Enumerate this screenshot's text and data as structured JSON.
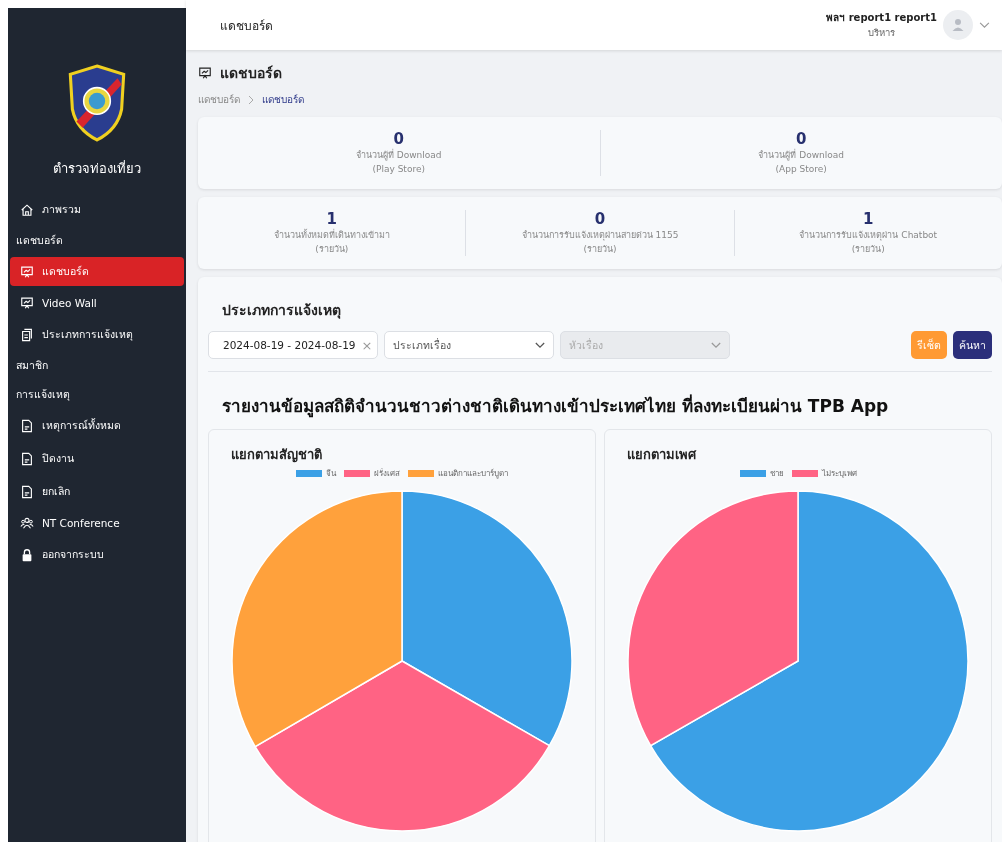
{
  "sidebar": {
    "brand": "ตำรวจท่องเที่ยว",
    "items": [
      {
        "kind": "link",
        "label": "ภาพรวม",
        "selected": false
      },
      {
        "kind": "section",
        "label": "แดชบอร์ด"
      },
      {
        "kind": "link",
        "label": "แดชบอร์ด",
        "selected": true
      },
      {
        "kind": "link",
        "label": "Video Wall",
        "selected": false
      },
      {
        "kind": "link",
        "label": "ประเภทการแจ้งเหตุ",
        "selected": false
      },
      {
        "kind": "section",
        "label": "สมาชิก"
      },
      {
        "kind": "section",
        "label": "การแจ้งเหตุ"
      },
      {
        "kind": "link",
        "label": "เหตุการณ์ทั้งหมด",
        "selected": false
      },
      {
        "kind": "link",
        "label": "ปิดงาน",
        "selected": false
      },
      {
        "kind": "link",
        "label": "ยกเลิก",
        "selected": false
      },
      {
        "kind": "link",
        "label": "NT Conference",
        "selected": false
      },
      {
        "kind": "link",
        "label": "ออกจากระบบ",
        "selected": false
      }
    ]
  },
  "header": {
    "title": "แดชบอร์ด",
    "user_name": "พลฯ report1 report1",
    "user_role": "บริหาร"
  },
  "page": {
    "title": "แดชบอร์ด",
    "breadcrumb": [
      "แดชบอร์ด",
      "แดชบอร์ด"
    ]
  },
  "stat_rows": [
    [
      {
        "value": "0",
        "label": "จำนวนผู้ที่ Download",
        "sub": "(Play Store)"
      },
      {
        "value": "0",
        "label": "จำนวนผู้ที่ Download",
        "sub": "(App Store)"
      }
    ],
    [
      {
        "value": "1",
        "label": "จำนวนทั้งหมดที่เดินทางเข้ามา",
        "sub": "(รายวัน)"
      },
      {
        "value": "0",
        "label": "จำนวนการรับแจ้งเหตุผ่านสายด่วน 1155",
        "sub": "(รายวัน)"
      },
      {
        "value": "1",
        "label": "จำนวนการรับแจ้งเหตุผ่าน Chatbot",
        "sub": "(รายวัน)"
      }
    ]
  ],
  "report": {
    "title": "ประเภทการแจ้งเหตุ",
    "filters": {
      "date_range": "2024-08-19 - 2024-08-19",
      "clear": "×",
      "type": {
        "placeholder": "ประเภทเรื่อง",
        "disabled": false
      },
      "topic": {
        "placeholder": "หัวเรื่อง",
        "disabled": true
      }
    },
    "buttons": {
      "reset": "รีเซ็ต",
      "search": "ค้นหา"
    },
    "heading": "รายงานข้อมูลสถิติจำนวนชาวต่างชาติเดินทางเข้าประเทศไทย ที่ลงทะเบียนผ่าน TPB App",
    "charts": [
      {
        "title": "แยกตามสัญชาติ",
        "chart_data": {
          "type": "pie",
          "categories": [
            "จีน",
            "ฝรั่งเศส",
            "แอนติกาและบาร์บูดา"
          ],
          "values": [
            33.3,
            33.3,
            33.4
          ],
          "colors": [
            "#3ba0e6",
            "#ff6384",
            "#ffa13c"
          ]
        }
      },
      {
        "title": "แยกตามเพศ",
        "chart_data": {
          "type": "pie",
          "categories": [
            "ชาย",
            "ไม่ระบุเพศ"
          ],
          "values": [
            66.7,
            33.3
          ],
          "colors": [
            "#3ba0e6",
            "#ff6384"
          ]
        }
      }
    ]
  }
}
